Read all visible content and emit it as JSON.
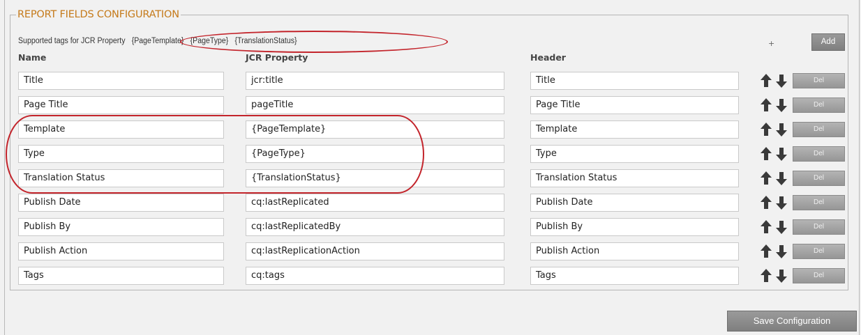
{
  "panel": {
    "legend": "REPORT FIELDS CONFIGURATION",
    "supported_label": "Supported tags for JCR Property",
    "supported_tags": [
      "{PageTemplate}",
      "{PageType}",
      "{TranslationStatus}"
    ],
    "add_button": "Add",
    "add_plus": "+",
    "headers": {
      "name": "Name",
      "jcr": "JCR Property",
      "header": "Header"
    }
  },
  "rows": [
    {
      "name": "Title",
      "jcr": "jcr:title",
      "header": "Title",
      "del": "Del"
    },
    {
      "name": "Page Title",
      "jcr": "pageTitle",
      "header": "Page Title",
      "del": "Del"
    },
    {
      "name": "Template",
      "jcr": "{PageTemplate}",
      "header": "Template",
      "del": "Del"
    },
    {
      "name": "Type",
      "jcr": "{PageType}",
      "header": "Type",
      "del": "Del"
    },
    {
      "name": "Translation Status",
      "jcr": "{TranslationStatus}",
      "header": "Translation Status",
      "del": "Del"
    },
    {
      "name": "Publish Date",
      "jcr": "cq:lastReplicated",
      "header": "Publish Date",
      "del": "Del"
    },
    {
      "name": "Publish By",
      "jcr": "cq:lastReplicatedBy",
      "header": "Publish By",
      "del": "Del"
    },
    {
      "name": "Publish Action",
      "jcr": "cq:lastReplicationAction",
      "header": "Publish Action",
      "del": "Del"
    },
    {
      "name": "Tags",
      "jcr": "cq:tags",
      "header": "Tags",
      "del": "Del"
    }
  ],
  "save_button": "Save Configuration",
  "colors": {
    "legend": "#c57a1a",
    "highlight_oval": "#c3242b",
    "button": "#8a8a8a"
  },
  "icons": {
    "move_up": "arrow-up-icon",
    "move_down": "arrow-down-icon"
  }
}
